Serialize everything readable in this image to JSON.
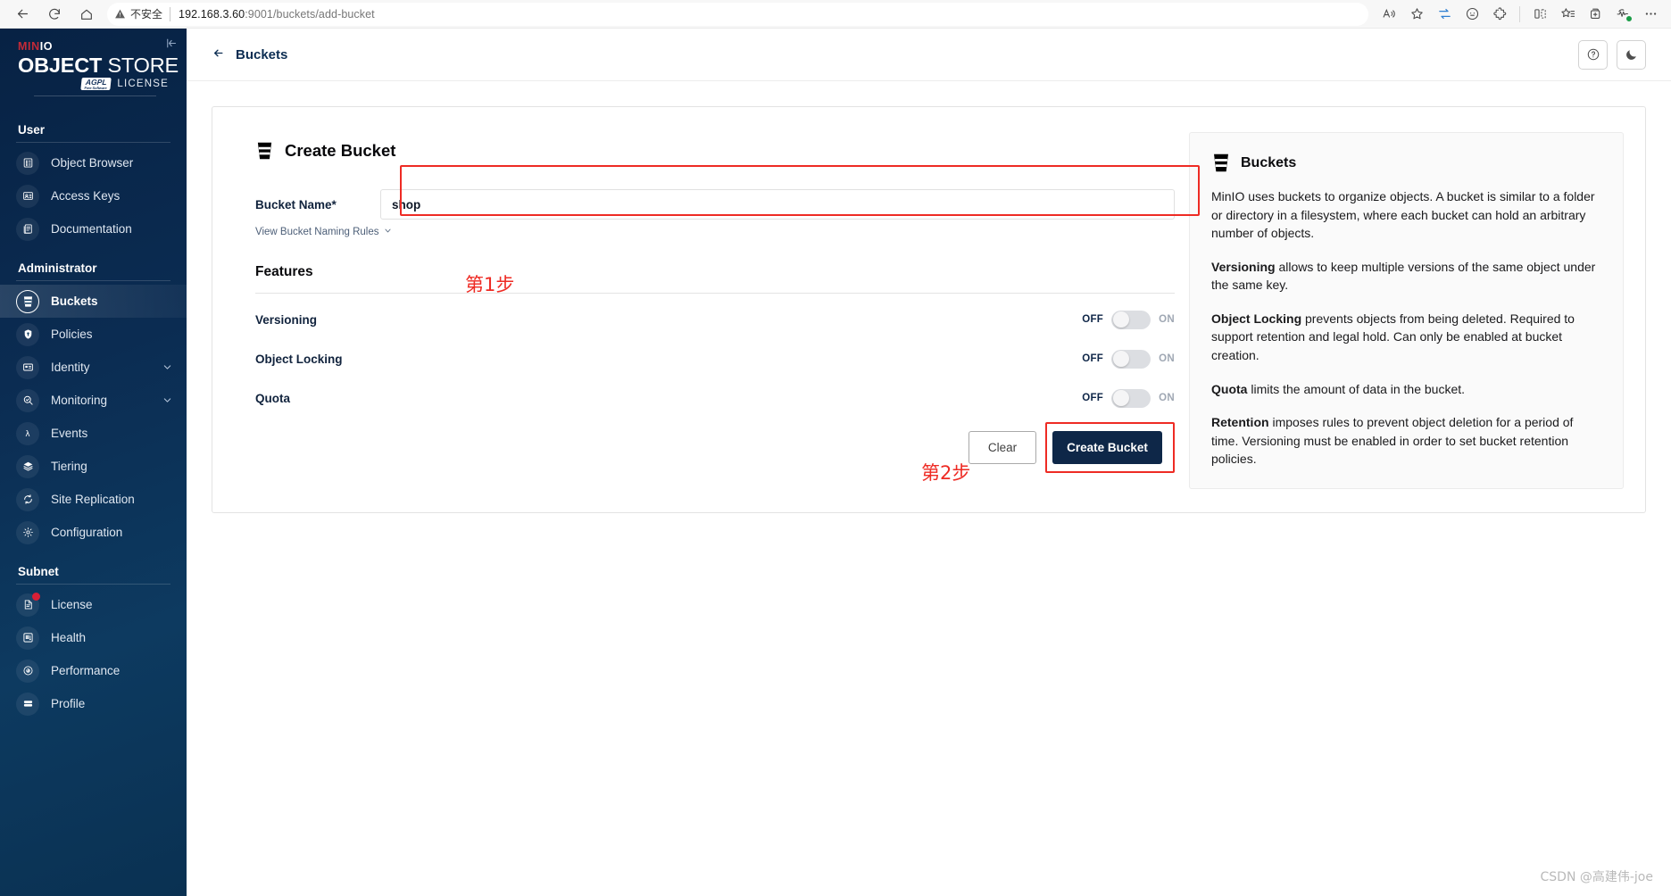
{
  "browser": {
    "back_icon": "back-arrow-icon",
    "reload_icon": "reload-icon",
    "home_icon": "home-icon",
    "security_label": "不安全",
    "url_host": "192.168.3.60",
    "url_rest": ":9001/buckets/add-bucket",
    "right_icons": [
      "read-aloud-icon",
      "favorite-star-icon",
      "browser-essentials-icon",
      "copilot-icon",
      "extensions-icon",
      "split-screen-icon",
      "collections-icon",
      "add-tab-group-icon",
      "performance-icon",
      "settings-and-more-icon"
    ]
  },
  "sidebar": {
    "logo": {
      "brand_prefix": "MIN",
      "brand_suffix": "IO",
      "title_bold": "OBJECT",
      "title_light": " STORE",
      "license_badge": "AGPL",
      "license_badge_version": "v3",
      "license_badge_sub": "Free Software",
      "license_word": "LICENSE"
    },
    "collapse_icon": "collapse-sidebar-icon",
    "sections": [
      {
        "label": "User",
        "items": [
          {
            "label": "Object Browser",
            "icon": "object-browser-icon",
            "active": false,
            "expandable": false,
            "badge": false
          },
          {
            "label": "Access Keys",
            "icon": "access-keys-icon",
            "active": false,
            "expandable": false,
            "badge": false
          },
          {
            "label": "Documentation",
            "icon": "documentation-icon",
            "active": false,
            "expandable": false,
            "badge": false
          }
        ]
      },
      {
        "label": "Administrator",
        "items": [
          {
            "label": "Buckets",
            "icon": "bucket-icon",
            "active": true,
            "expandable": false,
            "badge": false
          },
          {
            "label": "Policies",
            "icon": "policies-shield-icon",
            "active": false,
            "expandable": false,
            "badge": false
          },
          {
            "label": "Identity",
            "icon": "identity-card-icon",
            "active": false,
            "expandable": true,
            "badge": false
          },
          {
            "label": "Monitoring",
            "icon": "monitoring-search-icon",
            "active": false,
            "expandable": true,
            "badge": false
          },
          {
            "label": "Events",
            "icon": "events-lambda-icon",
            "active": false,
            "expandable": false,
            "badge": false
          },
          {
            "label": "Tiering",
            "icon": "tiering-layers-icon",
            "active": false,
            "expandable": false,
            "badge": false
          },
          {
            "label": "Site Replication",
            "icon": "site-replication-icon",
            "active": false,
            "expandable": false,
            "badge": false
          },
          {
            "label": "Configuration",
            "icon": "configuration-gear-icon",
            "active": false,
            "expandable": false,
            "badge": false
          }
        ]
      },
      {
        "label": "Subnet",
        "items": [
          {
            "label": "License",
            "icon": "license-doc-icon",
            "active": false,
            "expandable": false,
            "badge": true
          },
          {
            "label": "Health",
            "icon": "health-icon",
            "active": false,
            "expandable": false,
            "badge": false
          },
          {
            "label": "Performance",
            "icon": "performance-gauge-icon",
            "active": false,
            "expandable": false,
            "badge": false
          },
          {
            "label": "Profile",
            "icon": "profile-icon",
            "active": false,
            "expandable": false,
            "badge": false
          }
        ]
      }
    ]
  },
  "topbar": {
    "back_icon": "back-arrow-icon",
    "breadcrumb": "Buckets",
    "help_icon": "help-circle-icon",
    "theme_icon": "dark-mode-moon-icon"
  },
  "form": {
    "title": "Create Bucket",
    "title_icon": "bucket-icon",
    "bucket_name_label": "Bucket Name*",
    "bucket_name_value": "shop",
    "bucket_name_placeholder": "",
    "naming_rules_link": "View Bucket Naming Rules",
    "naming_rules_chevron": "chevron-down-icon",
    "features_title": "Features",
    "features": [
      {
        "name": "Versioning",
        "state": "OFF",
        "off_label": "OFF",
        "on_label": "ON"
      },
      {
        "name": "Object Locking",
        "state": "OFF",
        "off_label": "OFF",
        "on_label": "ON"
      },
      {
        "name": "Quota",
        "state": "OFF",
        "off_label": "OFF",
        "on_label": "ON"
      }
    ],
    "clear_button": "Clear",
    "create_button": "Create Bucket"
  },
  "info": {
    "title": "Buckets",
    "title_icon": "bucket-icon",
    "paragraphs": [
      {
        "bold": "",
        "text": "MinIO uses buckets to organize objects. A bucket is similar to a folder or directory in a filesystem, where each bucket can hold an arbitrary number of objects."
      },
      {
        "bold": "Versioning",
        "text": " allows to keep multiple versions of the same object under the same key."
      },
      {
        "bold": "Object Locking",
        "text": " prevents objects from being deleted. Required to support retention and legal hold. Can only be enabled at bucket creation."
      },
      {
        "bold": "Quota",
        "text": " limits the amount of data in the bucket."
      },
      {
        "bold": "Retention",
        "text": " imposes rules to prevent object deletion for a period of time. Versioning must be enabled in order to set bucket retention policies."
      }
    ]
  },
  "annotations": {
    "step1": "第1步",
    "step2": "第2步",
    "highlight_color": "#ee2b24"
  },
  "watermark": "CSDN @高建伟-joe"
}
